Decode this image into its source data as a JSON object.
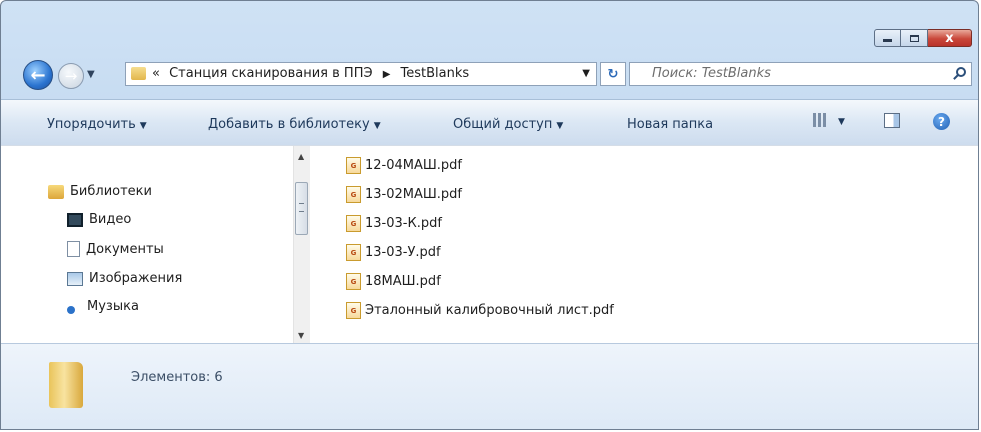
{
  "window": {
    "controls": {
      "minimize_icon": "minimize-icon",
      "maximize_icon": "maximize-icon",
      "close_label": "x"
    }
  },
  "address_bar": {
    "overflow": "«",
    "path": [
      "Станция сканирования в ППЭ",
      "TestBlanks"
    ]
  },
  "search": {
    "placeholder": "Поиск: TestBlanks"
  },
  "toolbar": {
    "organize": "Упорядочить",
    "add_to_library": "Добавить в библиотеку",
    "share": "Общий доступ",
    "new_folder": "Новая папка"
  },
  "nav_pane": {
    "root": "Библиотеки",
    "items": [
      {
        "label": "Видео",
        "icon": "video-icon"
      },
      {
        "label": "Документы",
        "icon": "documents-icon"
      },
      {
        "label": "Изображения",
        "icon": "pictures-icon"
      },
      {
        "label": "Музыка",
        "icon": "music-icon"
      }
    ]
  },
  "files": [
    {
      "name": "12-04МАШ.pdf"
    },
    {
      "name": "13-02МАШ.pdf"
    },
    {
      "name": "13-03-К.pdf"
    },
    {
      "name": "13-03-У.pdf"
    },
    {
      "name": "18МАШ.pdf"
    },
    {
      "name": "Эталонный калибровочный лист.pdf"
    }
  ],
  "details": {
    "count_text": "Элементов: 6"
  },
  "colors": {
    "accent": "#1e395b",
    "frame": "#c2d8ef",
    "close_button": "#c9473a"
  }
}
